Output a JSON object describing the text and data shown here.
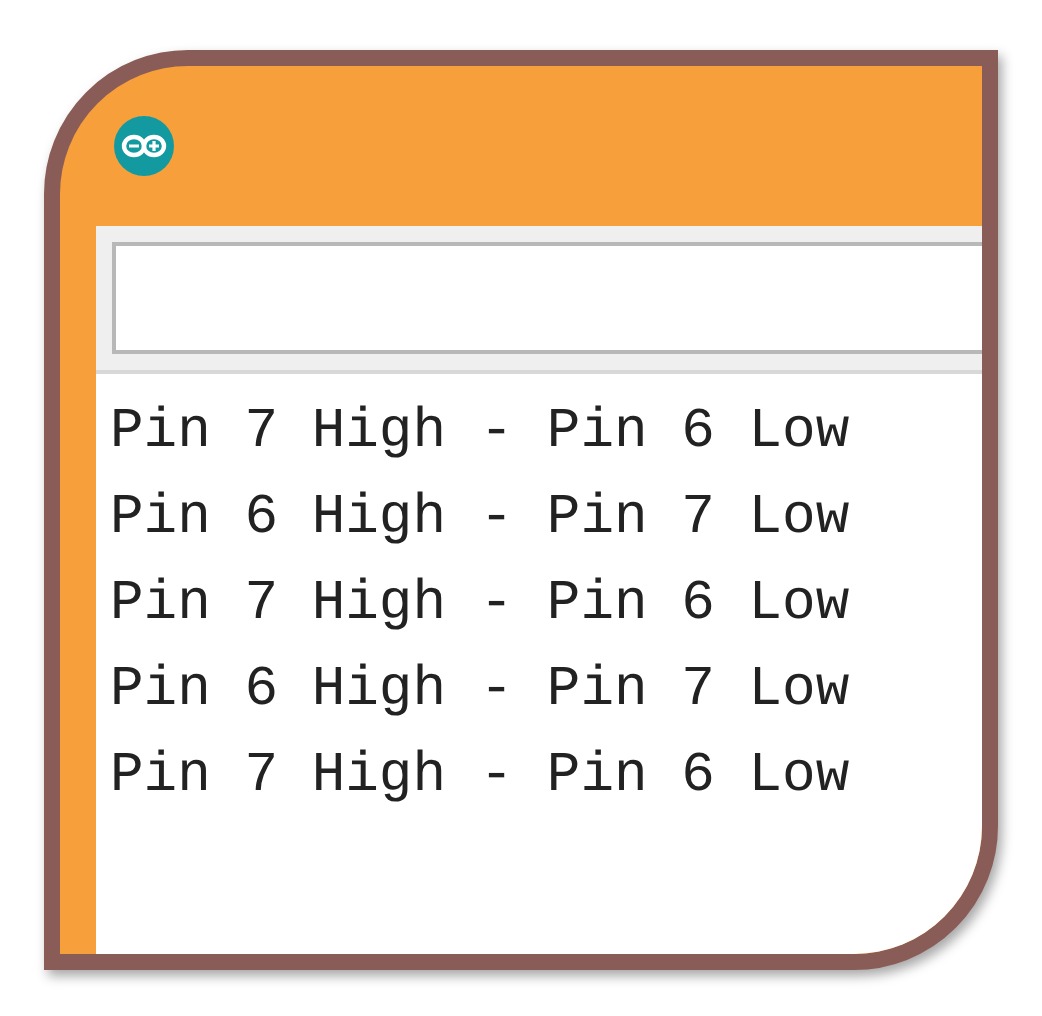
{
  "output_lines": [
    "Pin 7 High - Pin 6 Low",
    "Pin 6 High - Pin 7 Low",
    "Pin 7 High - Pin 6 Low",
    "Pin 6 High - Pin 7 Low",
    "Pin 7 High - Pin 6 Low"
  ]
}
